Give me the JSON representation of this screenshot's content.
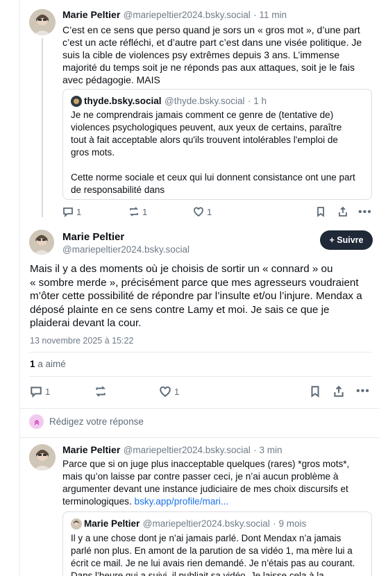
{
  "post1": {
    "author_name": "Marie Peltier",
    "author_handle": "@mariepeltier2024.bsky.social",
    "time": "· 11 min",
    "lines": [
      "C’est en ce sens que perso quand je sors un « gros mot », d’une part",
      "c’est un acte réfléchi, et d’autre part c’est dans une visée politique. Je",
      "suis la cible de violences psy extrêmes depuis 3 ans. L’immense",
      "majorité du temps soit je ne réponds pas aux attaques, soit je le fais",
      "avec pédagogie. MAIS"
    ],
    "quote": {
      "author_name": "thyde.bsky.social",
      "author_handle": "@thyde.bsky.social",
      "time": "· 1 h",
      "lines": [
        "Je ne comprendrais jamais comment ce genre de (tentative de)",
        "violences psychologiques peuvent, aux yeux de certains, paraître",
        "tout à fait acceptable alors qu'ils trouvent intolérables l'emploi de",
        "gros mots.",
        "",
        "Cette norme sociale et ceux qui lui donnent consistance ont une part",
        "de responsabilité dans"
      ]
    },
    "replies": "1",
    "reposts": "1",
    "likes": "1"
  },
  "main": {
    "author_name": "Marie Peltier",
    "author_handle": "@mariepeltier2024.bsky.social",
    "follow_label": "+ Suivre",
    "lines": [
      "Mais il y a des moments où je choisis de sortir un « connard » ou",
      "« sombre merde », précisément parce que mes agresseurs voudraient",
      "m’ôter cette possibilité de répondre par l’insulte et/ou l’injure. Mendax a",
      "déposé plainte en ce sens contre Lamy et moi. Je sais ce que je",
      "plaiderai devant la cour."
    ],
    "date": "13 novembre 2025 à 15:22",
    "likes_count": "1",
    "likes_label": "a aimé",
    "replies": "1",
    "likes": "1"
  },
  "compose": {
    "placeholder": "Rédigez votre réponse"
  },
  "post3": {
    "author_name": "Marie Peltier",
    "author_handle": "@mariepeltier2024.bsky.social",
    "time": "· 3 min",
    "lines": [
      "Parce que si on juge plus inacceptable quelques (rares) *gros mots*,",
      "mais qu’on laisse par contre passer ceci, je n’ai aucun problème à",
      "argumenter devant une instance judiciaire de mes choix discursifs et",
      "terminologiques."
    ],
    "link": "bsky.app/profile/mari...",
    "quote": {
      "author_name": "Marie Peltier",
      "author_handle": "@mariepeltier2024.bsky.social",
      "time": "· 9 mois",
      "lines": [
        "Il y a une chose dont je n’ai jamais parlé. Dont Mendax n’a jamais",
        "parlé non plus. En amont de la parution de sa vidéo 1, ma mère lui a",
        "écrit ce mail. Je ne lui avais rien demandé. Je n’étais pas au courant.",
        "Dans l’heure qui a suivi, il publiait sa vidéo. Je laisse cela à la"
      ]
    }
  }
}
